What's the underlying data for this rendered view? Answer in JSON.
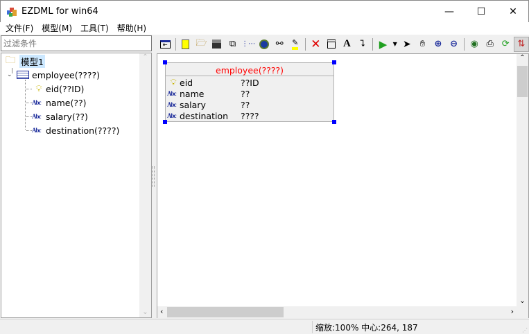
{
  "window": {
    "title": "EZDML for win64",
    "minimize": "—",
    "maximize": "☐",
    "close": "✕"
  },
  "menu": [
    {
      "label": "文件(F)"
    },
    {
      "label": "模型(M)"
    },
    {
      "label": "工具(T)"
    },
    {
      "label": "帮助(H)"
    }
  ],
  "filter": {
    "placeholder": "过滤条件"
  },
  "tree": {
    "root": "模型1",
    "table": "employee(????)",
    "fields": [
      "eid(??ID)",
      "name(??)",
      "salary(??)",
      "destination(????)"
    ]
  },
  "toolbar": {
    "icons": [
      "collapse-panel-icon",
      "new-icon",
      "open-icon",
      "save-icon",
      "copy-icon",
      "layout-icon",
      "globe-icon",
      "find-icon",
      "highlight-icon",
      "delete-icon",
      "table-icon",
      "text-icon",
      "link-icon",
      "run-icon",
      "dropdown-icon",
      "pointer-icon",
      "hand-icon",
      "zoom-in-icon",
      "zoom-out-icon",
      "view-icon",
      "print-icon",
      "refresh-icon",
      "swap-icon"
    ]
  },
  "entity": {
    "title": "employee(????)",
    "fields": [
      {
        "name": "eid",
        "type": "??ID",
        "pk": true
      },
      {
        "name": "name",
        "type": "??",
        "pk": false
      },
      {
        "name": "salary",
        "type": "??",
        "pk": false
      },
      {
        "name": "destination",
        "type": "????",
        "pk": false
      }
    ],
    "title_color": "#ff0000"
  },
  "status": {
    "text": "缩放:100% 中心:264, 187"
  }
}
